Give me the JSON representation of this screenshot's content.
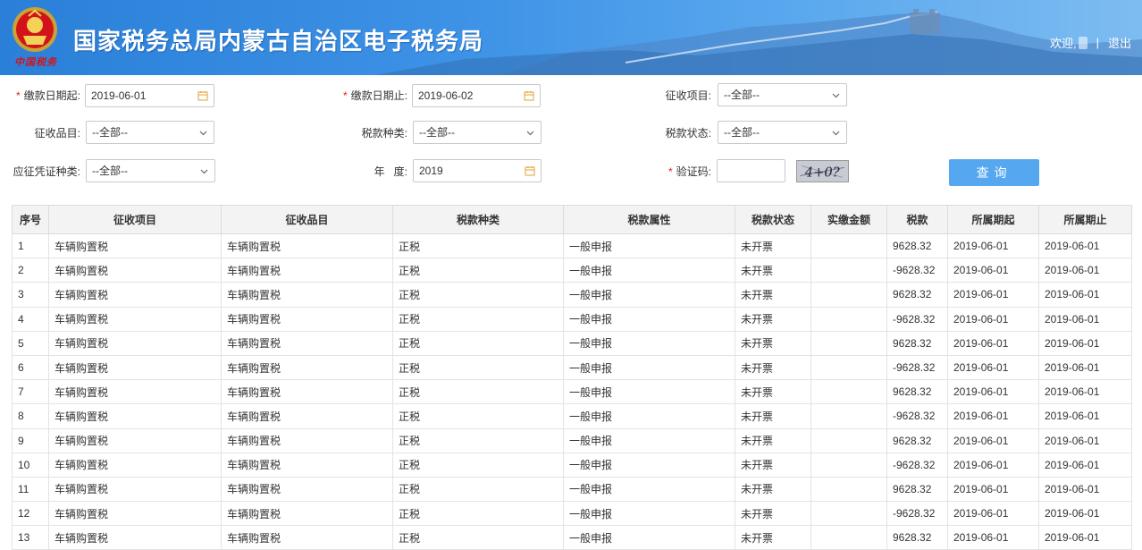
{
  "header": {
    "title": "国家税务总局内蒙古自治区电子税务局",
    "emblem_caption": "中国税务",
    "welcome": "欢迎,",
    "separator": "|",
    "logout": "退出"
  },
  "form": {
    "pay_date_start": {
      "label": "缴款日期起:",
      "required": "*",
      "value": "2019-06-01"
    },
    "pay_date_end": {
      "label": "缴款日期止:",
      "required": "*",
      "value": "2019-06-02"
    },
    "collect_item": {
      "label": "征收项目:",
      "value": "--全部--"
    },
    "collect_category": {
      "label": "征收品目:",
      "value": "--全部--"
    },
    "tax_type": {
      "label": "税款种类:",
      "value": "--全部--"
    },
    "tax_status": {
      "label": "税款状态:",
      "value": "--全部--"
    },
    "voucher_type": {
      "label": "应征凭证种类:",
      "value": "--全部--"
    },
    "year": {
      "label": "年   度:",
      "value": "2019"
    },
    "captcha": {
      "label": "验证码:",
      "required": "*",
      "value": "",
      "image_text": "4+0?"
    },
    "query_label": "查询"
  },
  "table": {
    "headers": [
      "序号",
      "征收项目",
      "征收品目",
      "税款种类",
      "税款属性",
      "税款状态",
      "实缴金额",
      "税款",
      "所属期起",
      "所属期止"
    ],
    "rows": [
      [
        "1",
        "车辆购置税",
        "车辆购置税",
        "正税",
        "一般申报",
        "未开票",
        "",
        "9628.32",
        "2019-06-01",
        "2019-06-01"
      ],
      [
        "2",
        "车辆购置税",
        "车辆购置税",
        "正税",
        "一般申报",
        "未开票",
        "",
        "-9628.32",
        "2019-06-01",
        "2019-06-01"
      ],
      [
        "3",
        "车辆购置税",
        "车辆购置税",
        "正税",
        "一般申报",
        "未开票",
        "",
        "9628.32",
        "2019-06-01",
        "2019-06-01"
      ],
      [
        "4",
        "车辆购置税",
        "车辆购置税",
        "正税",
        "一般申报",
        "未开票",
        "",
        "-9628.32",
        "2019-06-01",
        "2019-06-01"
      ],
      [
        "5",
        "车辆购置税",
        "车辆购置税",
        "正税",
        "一般申报",
        "未开票",
        "",
        "9628.32",
        "2019-06-01",
        "2019-06-01"
      ],
      [
        "6",
        "车辆购置税",
        "车辆购置税",
        "正税",
        "一般申报",
        "未开票",
        "",
        "-9628.32",
        "2019-06-01",
        "2019-06-01"
      ],
      [
        "7",
        "车辆购置税",
        "车辆购置税",
        "正税",
        "一般申报",
        "未开票",
        "",
        "9628.32",
        "2019-06-01",
        "2019-06-01"
      ],
      [
        "8",
        "车辆购置税",
        "车辆购置税",
        "正税",
        "一般申报",
        "未开票",
        "",
        "-9628.32",
        "2019-06-01",
        "2019-06-01"
      ],
      [
        "9",
        "车辆购置税",
        "车辆购置税",
        "正税",
        "一般申报",
        "未开票",
        "",
        "9628.32",
        "2019-06-01",
        "2019-06-01"
      ],
      [
        "10",
        "车辆购置税",
        "车辆购置税",
        "正税",
        "一般申报",
        "未开票",
        "",
        "-9628.32",
        "2019-06-01",
        "2019-06-01"
      ],
      [
        "11",
        "车辆购置税",
        "车辆购置税",
        "正税",
        "一般申报",
        "未开票",
        "",
        "9628.32",
        "2019-06-01",
        "2019-06-01"
      ],
      [
        "12",
        "车辆购置税",
        "车辆购置税",
        "正税",
        "一般申报",
        "未开票",
        "",
        "-9628.32",
        "2019-06-01",
        "2019-06-01"
      ],
      [
        "13",
        "车辆购置税",
        "车辆购置税",
        "正税",
        "一般申报",
        "未开票",
        "",
        "9628.32",
        "2019-06-01",
        "2019-06-01"
      ]
    ]
  },
  "colors": {
    "header_blue": "#3d92e6",
    "button_blue": "#55a8f0",
    "required_red": "#e02020"
  },
  "icons": {
    "calendar": "calendar-icon",
    "dropdown": "chevron-down-icon",
    "emblem": "tax-emblem-icon"
  }
}
